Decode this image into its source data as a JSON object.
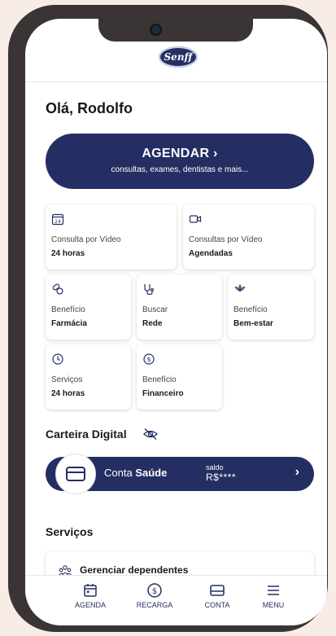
{
  "header": {
    "logo_text": "Senff"
  },
  "greeting": "Olá, Rodolfo",
  "agendar": {
    "title": "AGENDAR ›",
    "subtitle": "consultas, exames, dentistas e mais..."
  },
  "shortcuts": [
    {
      "icon": "calendar-24-icon",
      "line1": "Consulta por Vídeo",
      "line2": "24 horas"
    },
    {
      "icon": "video-camera-icon",
      "line1": "Consultas por Vídeo",
      "line2": "Agendadas"
    },
    {
      "icon": "pills-icon",
      "line1": "Benefício",
      "line2": "Farmácia"
    },
    {
      "icon": "stethoscope-icon",
      "line1": "Buscar",
      "line2": "Rede"
    },
    {
      "icon": "lotus-icon",
      "line1": "Benefício",
      "line2": "Bem-estar"
    },
    {
      "icon": "clock-icon",
      "line1": "Serviços",
      "line2": "24 horas"
    },
    {
      "icon": "dollar-coin-icon",
      "line1": "Benefício",
      "line2": "Financeiro"
    }
  ],
  "wallet": {
    "title": "Carteira Digital",
    "account_prefix": "Conta ",
    "account_bold": "Saúde",
    "saldo_label": "saldo",
    "saldo_value": "R$****"
  },
  "services": {
    "title": "Serviços",
    "items": [
      {
        "label": "Gerenciar dependentes",
        "icon": "people-icon"
      }
    ]
  },
  "bottom_nav": [
    {
      "label": "AGENDA",
      "icon": "calendar-icon"
    },
    {
      "label": "RECARGA",
      "icon": "dollar-coin-icon"
    },
    {
      "label": "CONTA",
      "icon": "card-icon"
    },
    {
      "label": "MENU",
      "icon": "hamburger-icon"
    }
  ],
  "colors": {
    "primary": "#252e62",
    "background": "#f8ece6",
    "frame": "#3a3534"
  }
}
